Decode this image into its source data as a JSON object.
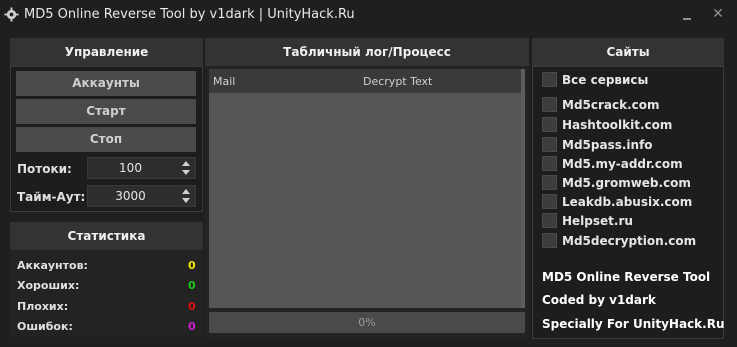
{
  "window": {
    "title": "MD5 Online Reverse Tool by v1dark | UnityHack.Ru",
    "minimize_icon": "minimize-icon",
    "close_label": "✕"
  },
  "control": {
    "header": "Управление",
    "accounts_button": "Аккаунты",
    "start_button": "Старт",
    "stop_button": "Стоп",
    "threads_label": "Потоки:",
    "threads_value": "100",
    "timeout_label": "Тайм-Аут:",
    "timeout_value": "3000"
  },
  "stats": {
    "header": "Статистика",
    "items": [
      {
        "label": "Аккаунтов:",
        "value": "0",
        "color": "#f5e600"
      },
      {
        "label": "Хороших:",
        "value": "0",
        "color": "#1ec81e"
      },
      {
        "label": "Плохих:",
        "value": "0",
        "color": "#e01010"
      },
      {
        "label": "Ошибок:",
        "value": "0",
        "color": "#d21fd2"
      }
    ]
  },
  "log": {
    "header": "Табличный лог/Процесс",
    "columns": [
      "Mail",
      "Decrypt Text"
    ],
    "progress_text": "0%",
    "progress_fraction": 0
  },
  "sites": {
    "header": "Сайты",
    "all_label": "Все сервисы",
    "items": [
      "Md5crack.com",
      "Hashtoolkit.com",
      "Md5pass.info",
      "Md5.my-addr.com",
      "Md5.gromweb.com",
      "Leakdb.abusix.com",
      "Helpset.ru",
      "Md5decryption.com"
    ],
    "info": [
      "MD5 Online Reverse Tool",
      "Coded by v1dark",
      "Specially For UnityHack.Ru"
    ]
  }
}
